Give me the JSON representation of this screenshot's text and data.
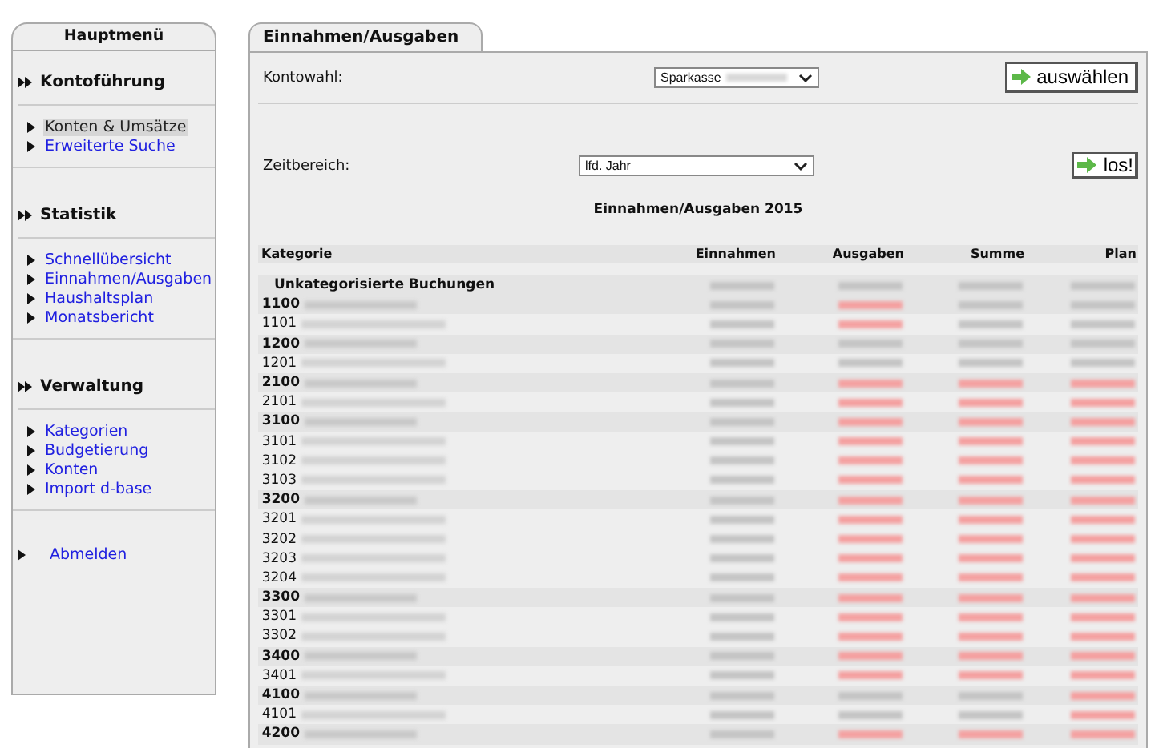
{
  "sidebar": {
    "title": "Hauptmenü",
    "sections": [
      {
        "heading": "Kontoführung",
        "items": [
          {
            "label": "Konten & Umsätze",
            "selected": true
          },
          {
            "label": "Erweiterte Suche",
            "selected": false
          }
        ]
      },
      {
        "heading": "Statistik",
        "items": [
          {
            "label": "Schnellübersicht",
            "selected": false
          },
          {
            "label": "Einnahmen/Ausgaben",
            "selected": false
          },
          {
            "label": "Haushaltsplan",
            "selected": false
          },
          {
            "label": "Monatsbericht",
            "selected": false
          }
        ]
      },
      {
        "heading": "Verwaltung",
        "items": [
          {
            "label": "Kategorien",
            "selected": false
          },
          {
            "label": "Budgetierung",
            "selected": false
          },
          {
            "label": "Konten",
            "selected": false
          },
          {
            "label": "Import d-base",
            "selected": false
          }
        ]
      }
    ],
    "logout": "Abmelden"
  },
  "tab": {
    "label": "Einnahmen/Ausgaben"
  },
  "account": {
    "label": "Kontowahl:",
    "value": "Sparkasse",
    "button": "auswählen"
  },
  "period": {
    "label": "Zeitbereich:",
    "value": "lfd. Jahr",
    "button": "los!"
  },
  "report": {
    "title": "Einnahmen/Ausgaben 2015",
    "columns": [
      "Kategorie",
      "Einnahmen",
      "Ausgaben",
      "Summe",
      "Plan"
    ],
    "rows": [
      {
        "kind": "header",
        "label": "Unkategorisierte Buchungen",
        "negative": [
          false,
          false,
          false,
          false
        ]
      },
      {
        "kind": "group",
        "code": "1100",
        "negative": [
          false,
          true,
          false,
          false
        ]
      },
      {
        "kind": "item",
        "code": "1101",
        "negative": [
          false,
          true,
          false,
          false
        ]
      },
      {
        "kind": "group",
        "code": "1200",
        "negative": [
          false,
          false,
          false,
          false
        ]
      },
      {
        "kind": "item",
        "code": "1201",
        "negative": [
          false,
          false,
          false,
          false
        ]
      },
      {
        "kind": "group",
        "code": "2100",
        "negative": [
          false,
          true,
          true,
          true
        ]
      },
      {
        "kind": "item",
        "code": "2101",
        "negative": [
          false,
          true,
          true,
          true
        ]
      },
      {
        "kind": "group",
        "code": "3100",
        "negative": [
          false,
          true,
          true,
          true
        ]
      },
      {
        "kind": "item",
        "code": "3101",
        "negative": [
          false,
          true,
          true,
          true
        ]
      },
      {
        "kind": "item",
        "code": "3102",
        "negative": [
          false,
          true,
          true,
          true
        ]
      },
      {
        "kind": "item",
        "code": "3103",
        "negative": [
          false,
          true,
          true,
          true
        ]
      },
      {
        "kind": "group",
        "code": "3200",
        "negative": [
          false,
          true,
          true,
          true
        ]
      },
      {
        "kind": "item",
        "code": "3201",
        "negative": [
          false,
          true,
          true,
          true
        ]
      },
      {
        "kind": "item",
        "code": "3202",
        "negative": [
          false,
          true,
          true,
          true
        ]
      },
      {
        "kind": "item",
        "code": "3203",
        "negative": [
          false,
          true,
          true,
          true
        ]
      },
      {
        "kind": "item",
        "code": "3204",
        "negative": [
          false,
          true,
          true,
          true
        ]
      },
      {
        "kind": "group",
        "code": "3300",
        "negative": [
          false,
          true,
          true,
          true
        ]
      },
      {
        "kind": "item",
        "code": "3301",
        "negative": [
          false,
          true,
          true,
          true
        ]
      },
      {
        "kind": "item",
        "code": "3302",
        "negative": [
          false,
          true,
          true,
          true
        ]
      },
      {
        "kind": "group",
        "code": "3400",
        "negative": [
          false,
          true,
          true,
          true
        ]
      },
      {
        "kind": "item",
        "code": "3401",
        "negative": [
          false,
          true,
          true,
          true
        ]
      },
      {
        "kind": "group",
        "code": "4100",
        "negative": [
          false,
          false,
          false,
          true
        ]
      },
      {
        "kind": "item",
        "code": "4101",
        "negative": [
          false,
          false,
          false,
          true
        ]
      },
      {
        "kind": "group",
        "code": "4200",
        "negative": [
          false,
          true,
          true,
          true
        ]
      }
    ]
  }
}
